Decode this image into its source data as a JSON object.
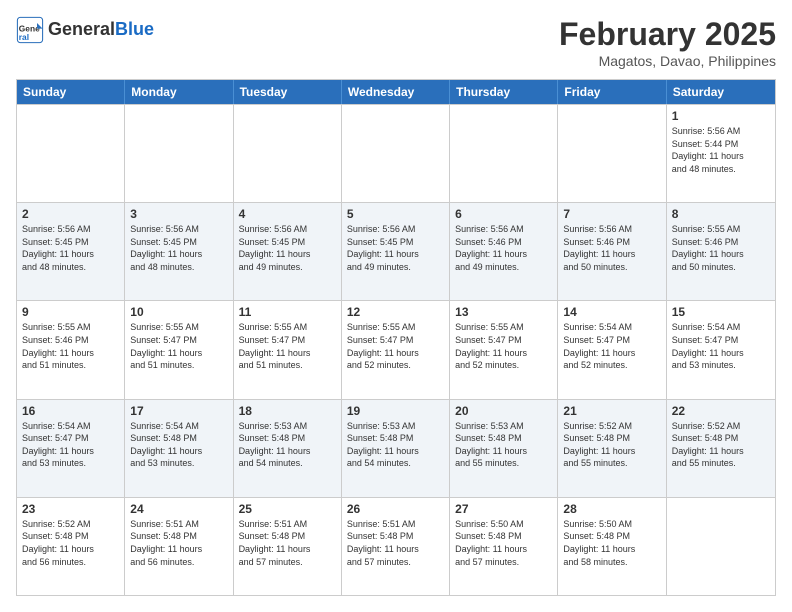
{
  "header": {
    "logo_line1": "General",
    "logo_line2": "Blue",
    "month_year": "February 2025",
    "location": "Magatos, Davao, Philippines"
  },
  "weekdays": [
    "Sunday",
    "Monday",
    "Tuesday",
    "Wednesday",
    "Thursday",
    "Friday",
    "Saturday"
  ],
  "rows": [
    {
      "alt": false,
      "cells": [
        {
          "day": "",
          "text": ""
        },
        {
          "day": "",
          "text": ""
        },
        {
          "day": "",
          "text": ""
        },
        {
          "day": "",
          "text": ""
        },
        {
          "day": "",
          "text": ""
        },
        {
          "day": "",
          "text": ""
        },
        {
          "day": "1",
          "text": "Sunrise: 5:56 AM\nSunset: 5:44 PM\nDaylight: 11 hours\nand 48 minutes."
        }
      ]
    },
    {
      "alt": true,
      "cells": [
        {
          "day": "2",
          "text": "Sunrise: 5:56 AM\nSunset: 5:45 PM\nDaylight: 11 hours\nand 48 minutes."
        },
        {
          "day": "3",
          "text": "Sunrise: 5:56 AM\nSunset: 5:45 PM\nDaylight: 11 hours\nand 48 minutes."
        },
        {
          "day": "4",
          "text": "Sunrise: 5:56 AM\nSunset: 5:45 PM\nDaylight: 11 hours\nand 49 minutes."
        },
        {
          "day": "5",
          "text": "Sunrise: 5:56 AM\nSunset: 5:45 PM\nDaylight: 11 hours\nand 49 minutes."
        },
        {
          "day": "6",
          "text": "Sunrise: 5:56 AM\nSunset: 5:46 PM\nDaylight: 11 hours\nand 49 minutes."
        },
        {
          "day": "7",
          "text": "Sunrise: 5:56 AM\nSunset: 5:46 PM\nDaylight: 11 hours\nand 50 minutes."
        },
        {
          "day": "8",
          "text": "Sunrise: 5:55 AM\nSunset: 5:46 PM\nDaylight: 11 hours\nand 50 minutes."
        }
      ]
    },
    {
      "alt": false,
      "cells": [
        {
          "day": "9",
          "text": "Sunrise: 5:55 AM\nSunset: 5:46 PM\nDaylight: 11 hours\nand 51 minutes."
        },
        {
          "day": "10",
          "text": "Sunrise: 5:55 AM\nSunset: 5:47 PM\nDaylight: 11 hours\nand 51 minutes."
        },
        {
          "day": "11",
          "text": "Sunrise: 5:55 AM\nSunset: 5:47 PM\nDaylight: 11 hours\nand 51 minutes."
        },
        {
          "day": "12",
          "text": "Sunrise: 5:55 AM\nSunset: 5:47 PM\nDaylight: 11 hours\nand 52 minutes."
        },
        {
          "day": "13",
          "text": "Sunrise: 5:55 AM\nSunset: 5:47 PM\nDaylight: 11 hours\nand 52 minutes."
        },
        {
          "day": "14",
          "text": "Sunrise: 5:54 AM\nSunset: 5:47 PM\nDaylight: 11 hours\nand 52 minutes."
        },
        {
          "day": "15",
          "text": "Sunrise: 5:54 AM\nSunset: 5:47 PM\nDaylight: 11 hours\nand 53 minutes."
        }
      ]
    },
    {
      "alt": true,
      "cells": [
        {
          "day": "16",
          "text": "Sunrise: 5:54 AM\nSunset: 5:47 PM\nDaylight: 11 hours\nand 53 minutes."
        },
        {
          "day": "17",
          "text": "Sunrise: 5:54 AM\nSunset: 5:48 PM\nDaylight: 11 hours\nand 53 minutes."
        },
        {
          "day": "18",
          "text": "Sunrise: 5:53 AM\nSunset: 5:48 PM\nDaylight: 11 hours\nand 54 minutes."
        },
        {
          "day": "19",
          "text": "Sunrise: 5:53 AM\nSunset: 5:48 PM\nDaylight: 11 hours\nand 54 minutes."
        },
        {
          "day": "20",
          "text": "Sunrise: 5:53 AM\nSunset: 5:48 PM\nDaylight: 11 hours\nand 55 minutes."
        },
        {
          "day": "21",
          "text": "Sunrise: 5:52 AM\nSunset: 5:48 PM\nDaylight: 11 hours\nand 55 minutes."
        },
        {
          "day": "22",
          "text": "Sunrise: 5:52 AM\nSunset: 5:48 PM\nDaylight: 11 hours\nand 55 minutes."
        }
      ]
    },
    {
      "alt": false,
      "cells": [
        {
          "day": "23",
          "text": "Sunrise: 5:52 AM\nSunset: 5:48 PM\nDaylight: 11 hours\nand 56 minutes."
        },
        {
          "day": "24",
          "text": "Sunrise: 5:51 AM\nSunset: 5:48 PM\nDaylight: 11 hours\nand 56 minutes."
        },
        {
          "day": "25",
          "text": "Sunrise: 5:51 AM\nSunset: 5:48 PM\nDaylight: 11 hours\nand 57 minutes."
        },
        {
          "day": "26",
          "text": "Sunrise: 5:51 AM\nSunset: 5:48 PM\nDaylight: 11 hours\nand 57 minutes."
        },
        {
          "day": "27",
          "text": "Sunrise: 5:50 AM\nSunset: 5:48 PM\nDaylight: 11 hours\nand 57 minutes."
        },
        {
          "day": "28",
          "text": "Sunrise: 5:50 AM\nSunset: 5:48 PM\nDaylight: 11 hours\nand 58 minutes."
        },
        {
          "day": "",
          "text": ""
        }
      ]
    }
  ]
}
